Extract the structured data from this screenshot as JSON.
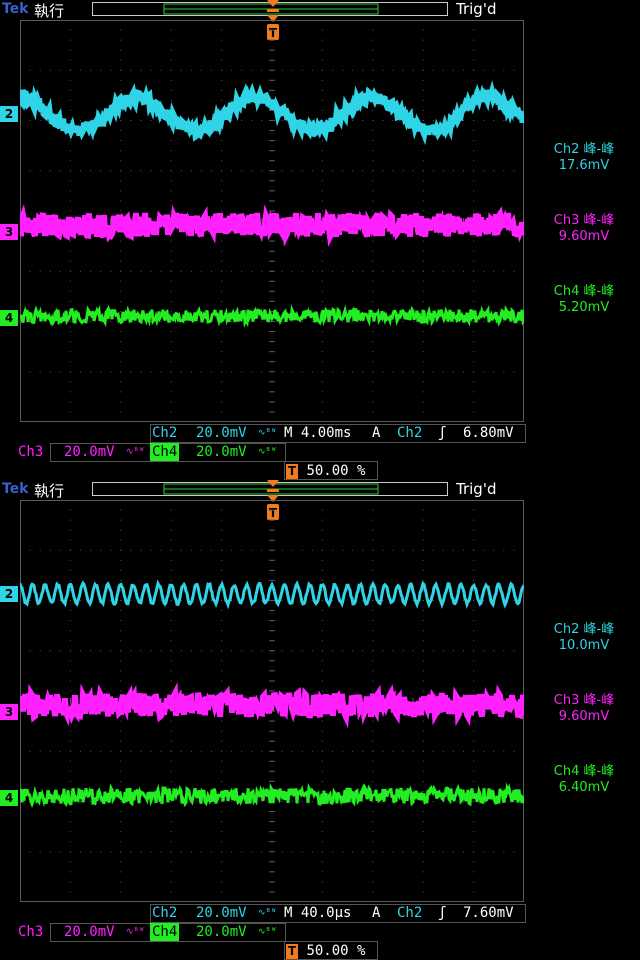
{
  "colors": {
    "ch2": "#2fd4e6",
    "ch3": "#ff22ff",
    "ch4": "#22ee22",
    "grid": "#5a5a5a",
    "trigger": "#f47a20",
    "brand": "#3a5fd0"
  },
  "screens": [
    {
      "brand": "Tek",
      "run_state": "執行",
      "trigger_state": "Trig'd",
      "measurements": [
        {
          "label": "Ch2 峰-峰",
          "value": "17.6mV"
        },
        {
          "label": "Ch3 峰-峰",
          "value": "9.60mV"
        },
        {
          "label": "Ch4 峰-峰",
          "value": "5.20mV"
        }
      ],
      "channel_markers": [
        "2",
        "3",
        "4"
      ],
      "status": {
        "ch2_name": "Ch2",
        "ch2_scale": "20.0mV",
        "timebase": "M 4.00ms",
        "trig_mode": "A",
        "trig_source": "Ch2",
        "trig_level": "6.80mV",
        "ch3_name": "Ch3",
        "ch3_scale": "20.0mV",
        "ch4_name": "Ch4",
        "ch4_scale": "20.0mV",
        "trig_position": "50.00 %"
      },
      "waveform": {
        "ch2_cycles": 4.3,
        "ch2_pp_mv": 17.6,
        "ch3_pp_mv": 9.6,
        "ch4_pp_mv": 5.2
      }
    },
    {
      "brand": "Tek",
      "run_state": "執行",
      "trigger_state": "Trig'd",
      "measurements": [
        {
          "label": "Ch2 峰-峰",
          "value": "10.0mV"
        },
        {
          "label": "Ch3 峰-峰",
          "value": "9.60mV"
        },
        {
          "label": "Ch4 峰-峰",
          "value": "6.40mV"
        }
      ],
      "channel_markers": [
        "2",
        "3",
        "4"
      ],
      "status": {
        "ch2_name": "Ch2",
        "ch2_scale": "20.0mV",
        "timebase": "M 40.0µs",
        "trig_mode": "A",
        "trig_source": "Ch2",
        "trig_level": "7.60mV",
        "ch3_name": "Ch3",
        "ch3_scale": "20.0mV",
        "ch4_name": "Ch4",
        "ch4_scale": "20.0mV",
        "trig_position": "50.00 %"
      },
      "waveform": {
        "ch2_cycles": 40,
        "ch2_pp_mv": 10.0,
        "ch3_pp_mv": 9.6,
        "ch4_pp_mv": 6.4
      }
    }
  ]
}
